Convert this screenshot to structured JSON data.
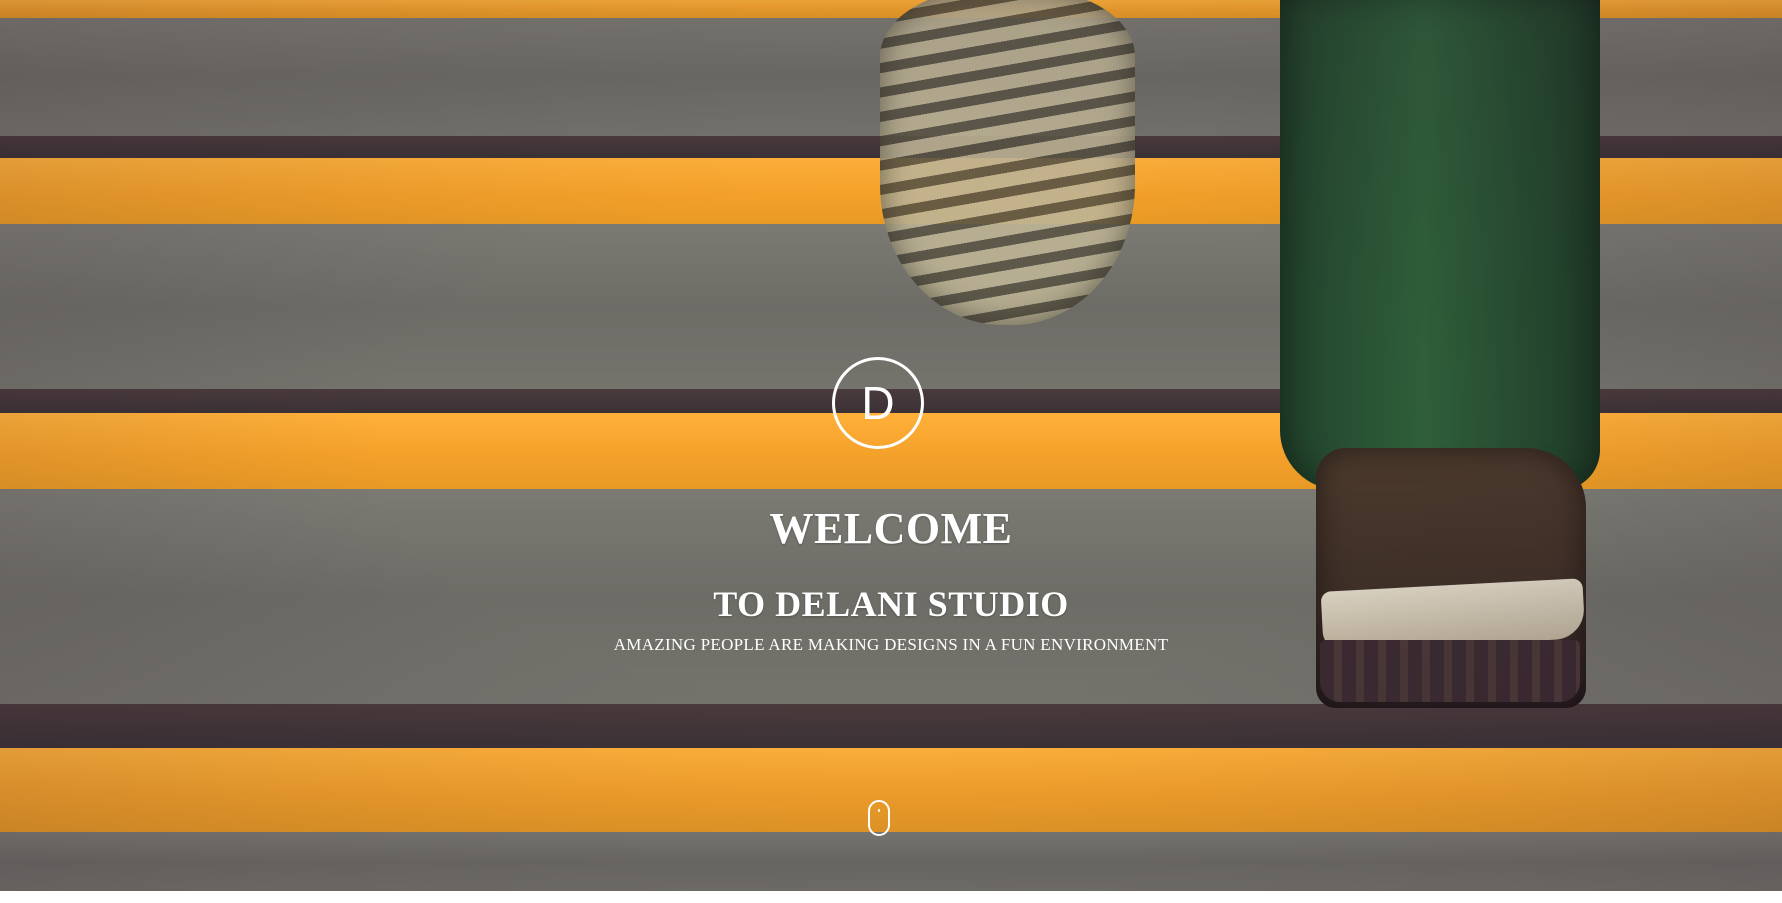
{
  "hero": {
    "logo_letter": "D",
    "title": "WELCOME",
    "subtitle": "TO DELANI STUDIO",
    "tagline": "AMAZING PEOPLE ARE MAKING DESIGNS IN A FUN ENVIRONMENT"
  },
  "colors": {
    "text": "#ffffff",
    "stair_orange": "#f4a12a",
    "stair_grey": "#6d6c66"
  },
  "icons": {
    "scroll_indicator": "mouse-scroll-icon"
  }
}
